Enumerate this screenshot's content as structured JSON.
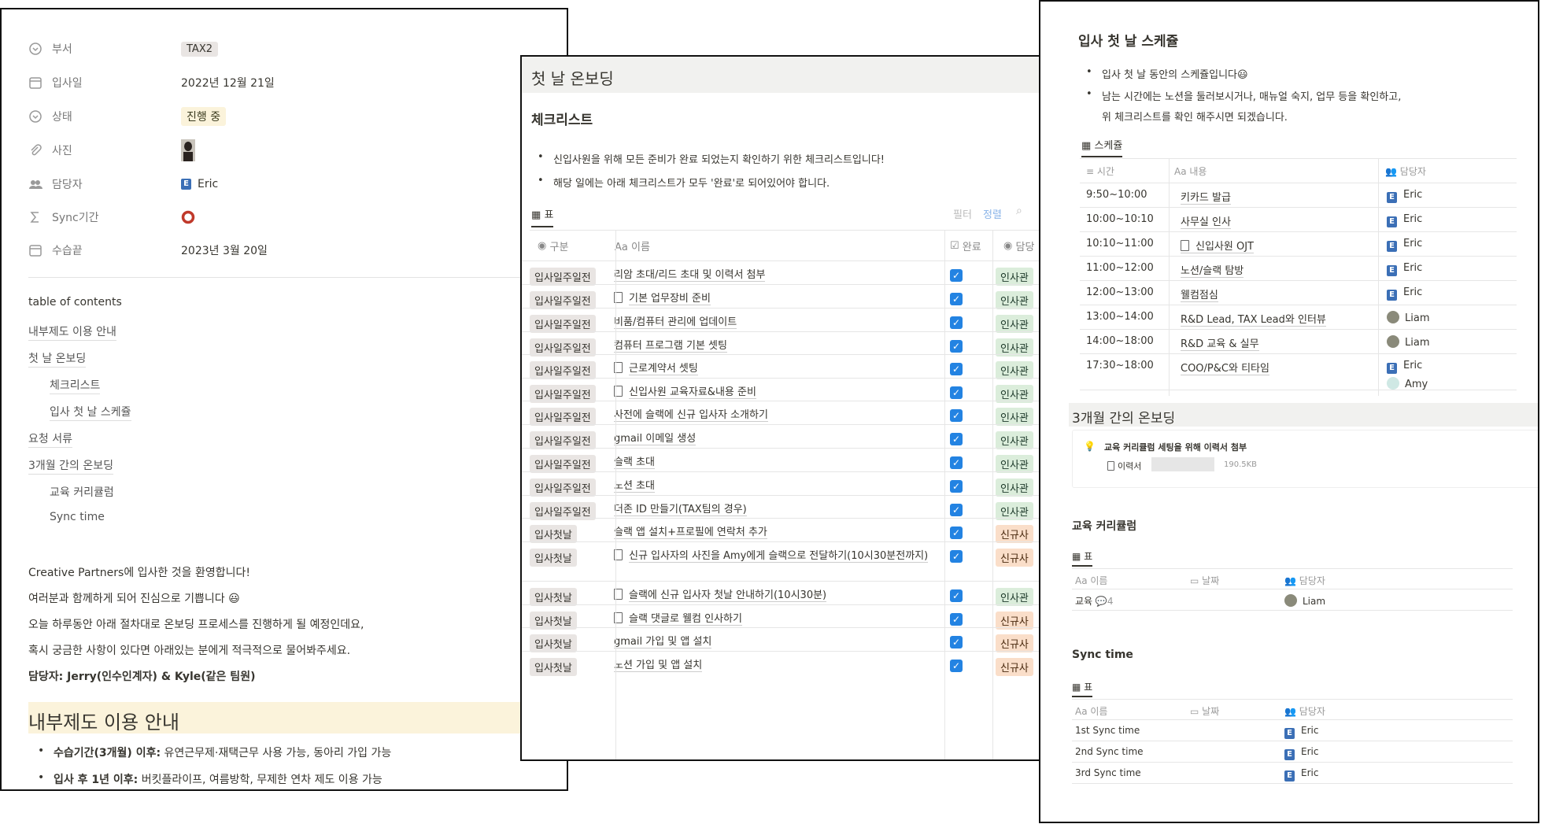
{
  "profile": {
    "props": [
      {
        "label": "부서",
        "value": "TAX2"
      },
      {
        "label": "입사일",
        "value": "2022년 12월 21일"
      },
      {
        "label": "상태",
        "value": "진행 중"
      },
      {
        "label": "사진",
        "value": ""
      },
      {
        "label": "담당자",
        "value": "Eric"
      },
      {
        "label": "Sync기간",
        "value": ""
      },
      {
        "label": "수습끝",
        "value": "2023년 3월 20일"
      }
    ],
    "toc_title": "table of contents",
    "toc": [
      "내부제도 이용 안내",
      "첫 날 온보딩",
      "체크리스트",
      "입사 첫 날 스케쥴",
      "요청 서류",
      "3개월 간의 온보딩",
      "교육 커리큘럼",
      "Sync time"
    ],
    "welcome": [
      "Creative Partners에 입사한 것을 환영합니다!",
      "여러분과 함께하게 되어 진심으로 기쁩니다 😃",
      "오늘 하루동안 아래 절차대로 온보딩 프로세스를 진행하게 될 예정인데요,",
      "혹시 궁금한 사항이 있다면 아래있는 분에게 적극적으로 물어봐주세요."
    ],
    "owner_line": "담당자:  Jerry(인수인계자) & Kyle(같은 팀원)",
    "policy_heading": "내부제도 이용 안내",
    "policies": [
      {
        "bold": "수습기간(3개월) 이후:",
        "text": " 유연근무제·재택근무 사용 가능, 동아리 가입 가능"
      },
      {
        "bold": "입사 후 1년 이후:",
        "text": " 버킷플라이프, 여름방학, 무제한 연차 제도 이용 가능"
      }
    ]
  },
  "onboarding": {
    "heading": "첫 날 온보딩",
    "sub": "체크리스트",
    "bullets": [
      "신입사원을 위해 모든 준비가 완료 되었는지 확인하기 위한 체크리스트입니다!",
      "해당 일에는 아래 체크리스트가 모두 '완료'로 되어있어야 합니다."
    ],
    "view": "표",
    "filter": "필터",
    "sort": "정렬",
    "cols": [
      "구분",
      "Aa 이름",
      "완료",
      "담당"
    ],
    "rows": [
      {
        "cat": "입사일주일전",
        "name": "리암 초대/리드 초대 및 이력서 첨부",
        "doc": false,
        "owner": "인사관",
        "color": "green",
        "h": 30
      },
      {
        "cat": "입사일주일전",
        "name": "기본 업무장비 준비",
        "doc": true,
        "owner": "인사관",
        "color": "green",
        "h": 30
      },
      {
        "cat": "입사일주일전",
        "name": "비품/컴퓨터 관리에 업데이트",
        "doc": false,
        "owner": "인사관",
        "color": "green",
        "h": 30
      },
      {
        "cat": "입사일주일전",
        "name": "컴퓨터 프로그램 기본 셋팅",
        "doc": false,
        "owner": "인사관",
        "color": "green",
        "h": 29
      },
      {
        "cat": "입사일주일전",
        "name": "근로계약서 셋팅",
        "doc": true,
        "owner": "인사관",
        "color": "green",
        "h": 30
      },
      {
        "cat": "입사일주일전",
        "name": "신입사원 교육자료&내용 준비",
        "doc": true,
        "owner": "인사관",
        "color": "green",
        "h": 29
      },
      {
        "cat": "입사일주일전",
        "name": "사전에 슬랙에 신규 입사자 소개하기",
        "doc": false,
        "owner": "인사관",
        "color": "green",
        "h": 30
      },
      {
        "cat": "입사일주일전",
        "name": "gmail 이메일 생성",
        "doc": false,
        "owner": "인사관",
        "color": "green",
        "h": 30
      },
      {
        "cat": "입사일주일전",
        "name": "슬랙 초대",
        "doc": false,
        "owner": "인사관",
        "color": "green",
        "h": 30
      },
      {
        "cat": "입사일주일전",
        "name": "노션 초대",
        "doc": false,
        "owner": "인사관",
        "color": "green",
        "h": 30
      },
      {
        "cat": "입사일주일전",
        "name": "더존 ID 만들기(TAX팀의 경우)",
        "doc": false,
        "owner": "인사관",
        "color": "green",
        "h": 29
      },
      {
        "cat": "입사첫날",
        "name": "슬랙 앱 설치+프로필에 연락처 추가",
        "doc": false,
        "owner": "신규사",
        "color": "orange",
        "h": 30
      },
      {
        "cat": "입사첫날",
        "name": "신규 입사자의 사진을 Amy에게 슬랙으로 전달하기(10시30분전까지)",
        "doc": true,
        "owner": "신규사",
        "color": "orange",
        "h": 50
      },
      {
        "cat": "입사첫날",
        "name": "슬랙에 신규 입사자 첫날 안내하기(10시30분)",
        "doc": true,
        "owner": "인사관",
        "color": "green",
        "h": 30
      },
      {
        "cat": "입사첫날",
        "name": "슬랙 댓글로 웰컴 인사하기",
        "doc": true,
        "owner": "신규사",
        "color": "orange",
        "h": 29
      },
      {
        "cat": "입사첫날",
        "name": "gmail 가입 및 앱 설치",
        "doc": false,
        "owner": "신규사",
        "color": "orange",
        "h": 30
      },
      {
        "cat": "입사첫날",
        "name": "노션 가입 및 앱 설치",
        "doc": false,
        "owner": "신규사",
        "color": "orange",
        "h": 30
      }
    ]
  },
  "schedule": {
    "heading": "입사 첫 날 스케쥴",
    "bullets": [
      "입사 첫 날 동안의 스케쥴입니다😃",
      "남는 시간에는 노션을 둘러보시거나, 매뉴얼 숙지, 업무 등을 확인하고,",
      "위 체크리스트를 확인 해주시면 되겠습니다."
    ],
    "view": "스케쥴",
    "cols": [
      "시간",
      "Aa 내용",
      "담당자"
    ],
    "rows": [
      {
        "time": "9:50~10:00",
        "what": "키카드 발급",
        "doc": false,
        "who": "Eric",
        "type": "eric"
      },
      {
        "time": "10:00~10:10",
        "what": "사무실 인사",
        "doc": false,
        "who": "Eric",
        "type": "eric"
      },
      {
        "time": "10:10~11:00",
        "what": "신입사원 OJT",
        "doc": true,
        "who": "Eric",
        "type": "eric"
      },
      {
        "time": "11:00~12:00",
        "what": "노션/슬랙 탐방",
        "doc": false,
        "who": "Eric",
        "type": "eric"
      },
      {
        "time": "12:00~13:00",
        "what": "웰컴점심",
        "doc": false,
        "who": "Eric",
        "type": "eric"
      },
      {
        "time": "13:00~14:00",
        "what": "R&D Lead, TAX Lead와 인터뷰",
        "doc": false,
        "who": "Liam",
        "type": "liam"
      },
      {
        "time": "14:00~18:00",
        "what": "R&D 교육 & 실무",
        "doc": false,
        "who": "Liam",
        "type": "liam"
      },
      {
        "time": "17:30~18:00",
        "what": "COO/P&C와 티타임",
        "doc": false,
        "who": "Eric",
        "who2": "Amy",
        "type": "eric"
      }
    ],
    "three_month": "3개월 간의 온보딩",
    "callout": "교육 커리큘럼 세팅을 위해 이력서 첨부",
    "file_label": "이력서",
    "file_size": "190.5KB",
    "curriculum": {
      "heading": "교육 커리큘럼",
      "view": "표",
      "cols": [
        "Aa 이름",
        "날짜",
        "담당자"
      ],
      "rows": [
        {
          "name": "교육",
          "comments": "4",
          "who": "Liam"
        }
      ]
    },
    "sync": {
      "heading": "Sync time",
      "view": "표",
      "cols": [
        "Aa 이름",
        "날짜",
        "담당자"
      ],
      "rows": [
        {
          "name": "1st Sync time",
          "who": "Eric"
        },
        {
          "name": "2nd Sync time",
          "who": "Eric"
        },
        {
          "name": "3rd Sync time",
          "who": "Eric"
        }
      ]
    }
  }
}
